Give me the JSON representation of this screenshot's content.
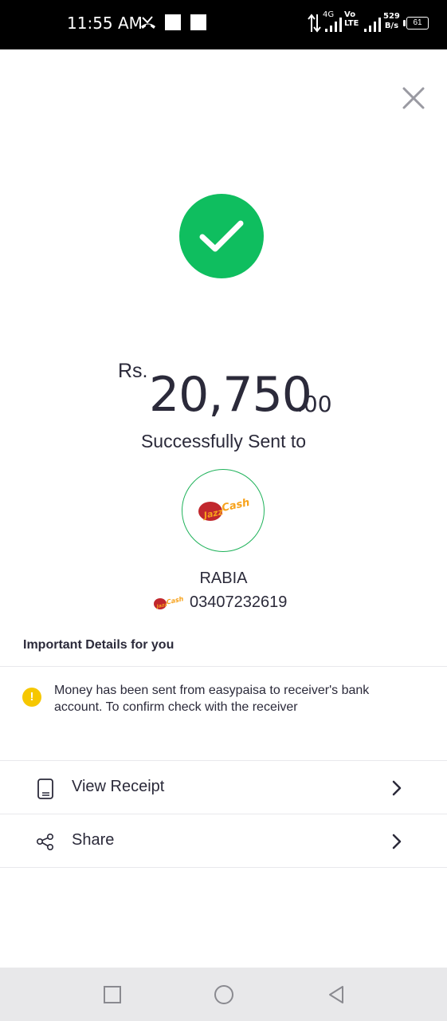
{
  "status_bar": {
    "time": "11:55 AM",
    "network_4g": "4G",
    "network_volte": "Vo LTE",
    "speed_value": "529",
    "speed_unit": "B/s",
    "battery": "61"
  },
  "transaction": {
    "currency": "Rs.",
    "amount_main": "20,750",
    "amount_decimal": ".00",
    "status_text": "Successfully Sent to"
  },
  "receiver": {
    "logo_name": "JazzCash",
    "name": "RABIA",
    "number": "03407232619"
  },
  "details": {
    "title": "Important Details for you",
    "notice": "Money has been sent from easypaisa to receiver's bank account. To confirm check with the receiver"
  },
  "actions": [
    {
      "label": "View Receipt",
      "icon": "receipt-icon"
    },
    {
      "label": "Share",
      "icon": "share-icon"
    }
  ],
  "colors": {
    "success": "#0fbe5f",
    "warning": "#f6c700",
    "text": "#2b2a3a",
    "jazzcash_red": "#c1272d",
    "jazzcash_orange": "#f7a21b"
  }
}
